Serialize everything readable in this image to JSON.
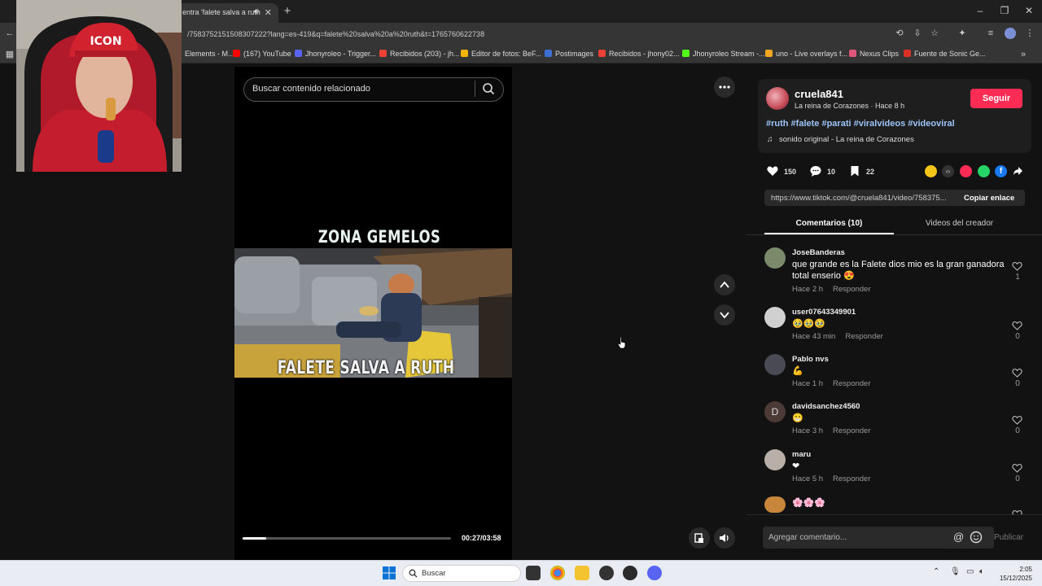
{
  "browser": {
    "active_tab_title": "entra 'falete salva a ruth",
    "url": "/7583752151508307222?lang=es-419&q=falete%20salva%20a%20ruth&t=1765760622738",
    "bookmarks": [
      {
        "label": "Elements - M...",
        "color": "#1a73e8"
      },
      {
        "label": "(167) YouTube",
        "color": "#ff0000"
      },
      {
        "label": "Jhonyroleo - Trigger...",
        "color": "#5865f2"
      },
      {
        "label": "Recibidos (203) - jh...",
        "color": "#ea4335"
      },
      {
        "label": "Editor de fotos: BeF...",
        "color": "#f4b400"
      },
      {
        "label": "Postimages",
        "color": "#3d6fd1"
      },
      {
        "label": "Recibidos - jhony02...",
        "color": "#ea4335"
      },
      {
        "label": "Jhonyroleo Stream -...",
        "color": "#53fc18"
      },
      {
        "label": "uno - Live overlays f...",
        "color": "#f5a623"
      },
      {
        "label": "Nexus Clips",
        "color": "#e0567a"
      },
      {
        "label": "Fuente de Sonic Ge...",
        "color": "#d93025"
      }
    ]
  },
  "video": {
    "search_placeholder": "Buscar contenido relacionado",
    "caption_top": "ZONA GEMELOS",
    "caption_bottom": "FALETE SALVA A RUTH",
    "time": "00:27/03:58",
    "progress": 0.113
  },
  "author": {
    "name": "cruela841",
    "subtitle": "La reina de Corazones · Hace 8 h",
    "follow_label": "Seguir",
    "hashtags": "#ruth #falete #parati #viralvideos #videoviral",
    "sound": "sonido original - La reina de Corazones"
  },
  "stats": {
    "likes": "150",
    "comments": "10",
    "saves": "22"
  },
  "link": {
    "url": "https://www.tiktok.com/@cruela841/video/758375...",
    "copy_label": "Copiar enlace"
  },
  "tabs": {
    "comments": "Comentarios (10)",
    "videos": "Videos del creador"
  },
  "comments": [
    {
      "user": "JoseBanderas",
      "text": "que grande es la Falete dios mio es la gran ganadora total enserio 😍",
      "time": "Hace 2 h",
      "reply": "Responder",
      "likes": "1",
      "avatar_color": "#7a8a6a"
    },
    {
      "user": "user07643349901",
      "text": "🥹🥹🥹",
      "time": "Hace 43 min",
      "reply": "Responder",
      "likes": "0",
      "avatar_color": "#d0d0d0"
    },
    {
      "user": "Pablo nvs",
      "text": "💪",
      "time": "Hace 1 h",
      "reply": "Responder",
      "likes": "0",
      "avatar_color": "#4a4a55"
    },
    {
      "user": "davidsanchez4560",
      "text": "😁",
      "time": "Hace 3 h",
      "reply": "Responder",
      "likes": "0",
      "avatar_color": "#4b3a36",
      "initial": "D"
    },
    {
      "user": "maru",
      "text": "❤",
      "time": "Hace 5 h",
      "reply": "Responder",
      "likes": "0",
      "avatar_color": "#b8b0a8"
    },
    {
      "user": "",
      "text": "🌸🌸🌸",
      "time": "",
      "reply": "",
      "likes": "",
      "avatar_color": "#c8863a"
    }
  ],
  "comment_bar": {
    "placeholder": "Agregar comentario...",
    "publish": "Publicar"
  },
  "taskbar": {
    "search": "Buscar",
    "time": "2:05",
    "date": "15/12/2025"
  }
}
